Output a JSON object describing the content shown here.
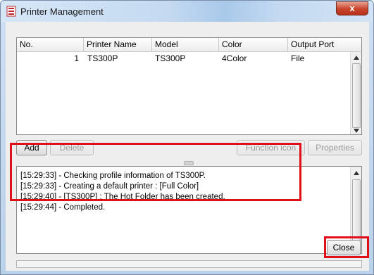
{
  "window": {
    "title": "Printer Management",
    "close_glyph": "x"
  },
  "table": {
    "columns": [
      "No.",
      "Printer Name",
      "Model",
      "Color",
      "Output Port"
    ],
    "rows": [
      {
        "no": "1",
        "printer_name": "TS300P",
        "model": "TS300P",
        "color": "4Color",
        "output_port": "File"
      }
    ]
  },
  "buttons": {
    "add": "Add",
    "delete": "Delete",
    "function_icon": "Function icon",
    "properties": "Properties",
    "close": "Close"
  },
  "log": {
    "lines": [
      "[15:29:33] - Checking profile information of TS300P.",
      "[15:29:33] - Creating a default printer : [Full Color]",
      "[15:29:40] - [TS300P] : The Hot Folder has been created.",
      "[15:29:44] - Completed."
    ]
  },
  "icons": {
    "app": "printer-management-icon",
    "close": "close-icon",
    "scroll_up": "scroll-up-arrow-icon",
    "scroll_down": "scroll-down-arrow-icon"
  },
  "colors": {
    "annotation": "#e0101a",
    "close_button": "#c7432a"
  }
}
